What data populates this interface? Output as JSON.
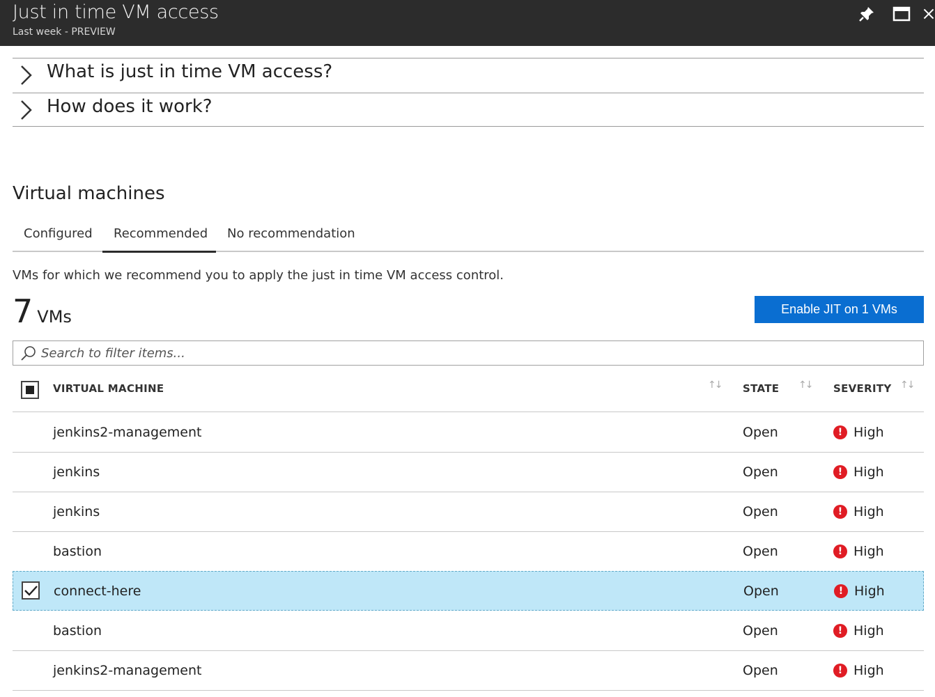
{
  "header": {
    "title": "Just in time VM access",
    "subtitle": "Last week - PREVIEW"
  },
  "expanders": [
    {
      "label": "What is just in time VM access?"
    },
    {
      "label": "How does it work?"
    }
  ],
  "section_title": "Virtual machines",
  "tabs": [
    {
      "label": "Configured",
      "selected": false
    },
    {
      "label": "Recommended",
      "selected": true
    },
    {
      "label": "No recommendation",
      "selected": false
    }
  ],
  "description": "VMs for which we recommend you to apply the just in time VM access control.",
  "vm_count": {
    "number": "7",
    "unit": "VMs"
  },
  "enable_button": "Enable JIT on 1 VMs",
  "search": {
    "placeholder": "Search to filter items...",
    "value": ""
  },
  "columns": {
    "vm": "VIRTUAL MACHINE",
    "state": "STATE",
    "severity": "SEVERITY"
  },
  "sort_glyph": "↑↓",
  "severity_glyph": "!",
  "rows": [
    {
      "name": "jenkins2-management",
      "state": "Open",
      "severity": "High",
      "selected": false
    },
    {
      "name": "jenkins",
      "state": "Open",
      "severity": "High",
      "selected": false
    },
    {
      "name": "jenkins",
      "state": "Open",
      "severity": "High",
      "selected": false
    },
    {
      "name": "bastion",
      "state": "Open",
      "severity": "High",
      "selected": false
    },
    {
      "name": "connect-here",
      "state": "Open",
      "severity": "High",
      "selected": true
    },
    {
      "name": "bastion",
      "state": "Open",
      "severity": "High",
      "selected": false
    },
    {
      "name": "jenkins2-management",
      "state": "Open",
      "severity": "High",
      "selected": false
    }
  ],
  "colors": {
    "header_bg": "#2c2c2c",
    "accent_button": "#0a6ed1",
    "selected_row": "#bfe7f8",
    "severity_high": "#e01c24"
  }
}
